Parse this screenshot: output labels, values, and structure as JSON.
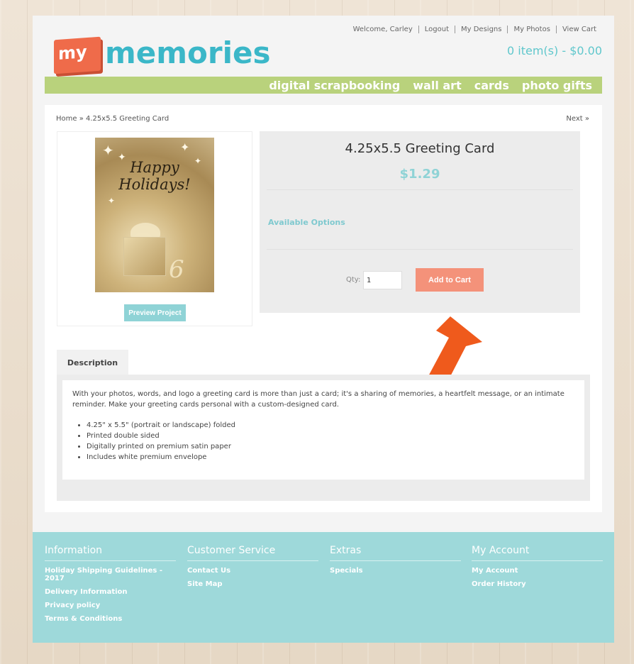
{
  "header": {
    "topnav": [
      "Welcome, Carley",
      "Logout",
      "My Designs",
      "My Photos",
      "View Cart"
    ],
    "cart_summary": "0 item(s) - $0.00",
    "logo": {
      "badge": "my",
      "word": "memories"
    },
    "nav": [
      "digital scrapbooking",
      "wall art",
      "cards",
      "photo gifts"
    ]
  },
  "breadcrumb": "Home » 4.25x5.5 Greeting Card",
  "next_link": "Next »",
  "product": {
    "image_text": "Happy Holidays!",
    "preview_label": "Preview Project",
    "title": "4.25x5.5 Greeting Card",
    "price": "$1.29",
    "options_label": "Available Options",
    "qty_label": "Qty:",
    "qty_value": "1",
    "add_to_cart_label": "Add to Cart"
  },
  "description": {
    "tab_label": "Description",
    "paragraph": "With your photos, words, and logo a greeting card is more than just a card; it's a sharing of memories, a heartfelt message, or an intimate reminder. Make your greeting cards personal with a custom-designed card.",
    "bullets": [
      "4.25\" x 5.5\" (portrait or landscape) folded",
      "Printed double sided",
      "Digitally printed on premium satin paper",
      "Includes white premium envelope"
    ]
  },
  "footer": {
    "columns": [
      {
        "title": "Information",
        "links": [
          "Holiday Shipping Guidelines - 2017",
          "Delivery Information",
          "Privacy policy",
          "Terms & Conditions"
        ]
      },
      {
        "title": "Customer Service",
        "links": [
          "Contact Us",
          "Site Map"
        ]
      },
      {
        "title": "Extras",
        "links": [
          "Specials"
        ]
      },
      {
        "title": "My Account",
        "links": [
          "My Account",
          "Order History"
        ]
      }
    ]
  },
  "colors": {
    "accent_teal": "#8fd3d6",
    "nav_green": "#b9d27c",
    "cart_button": "#f4927a",
    "arrow": "#ef5a1c"
  }
}
